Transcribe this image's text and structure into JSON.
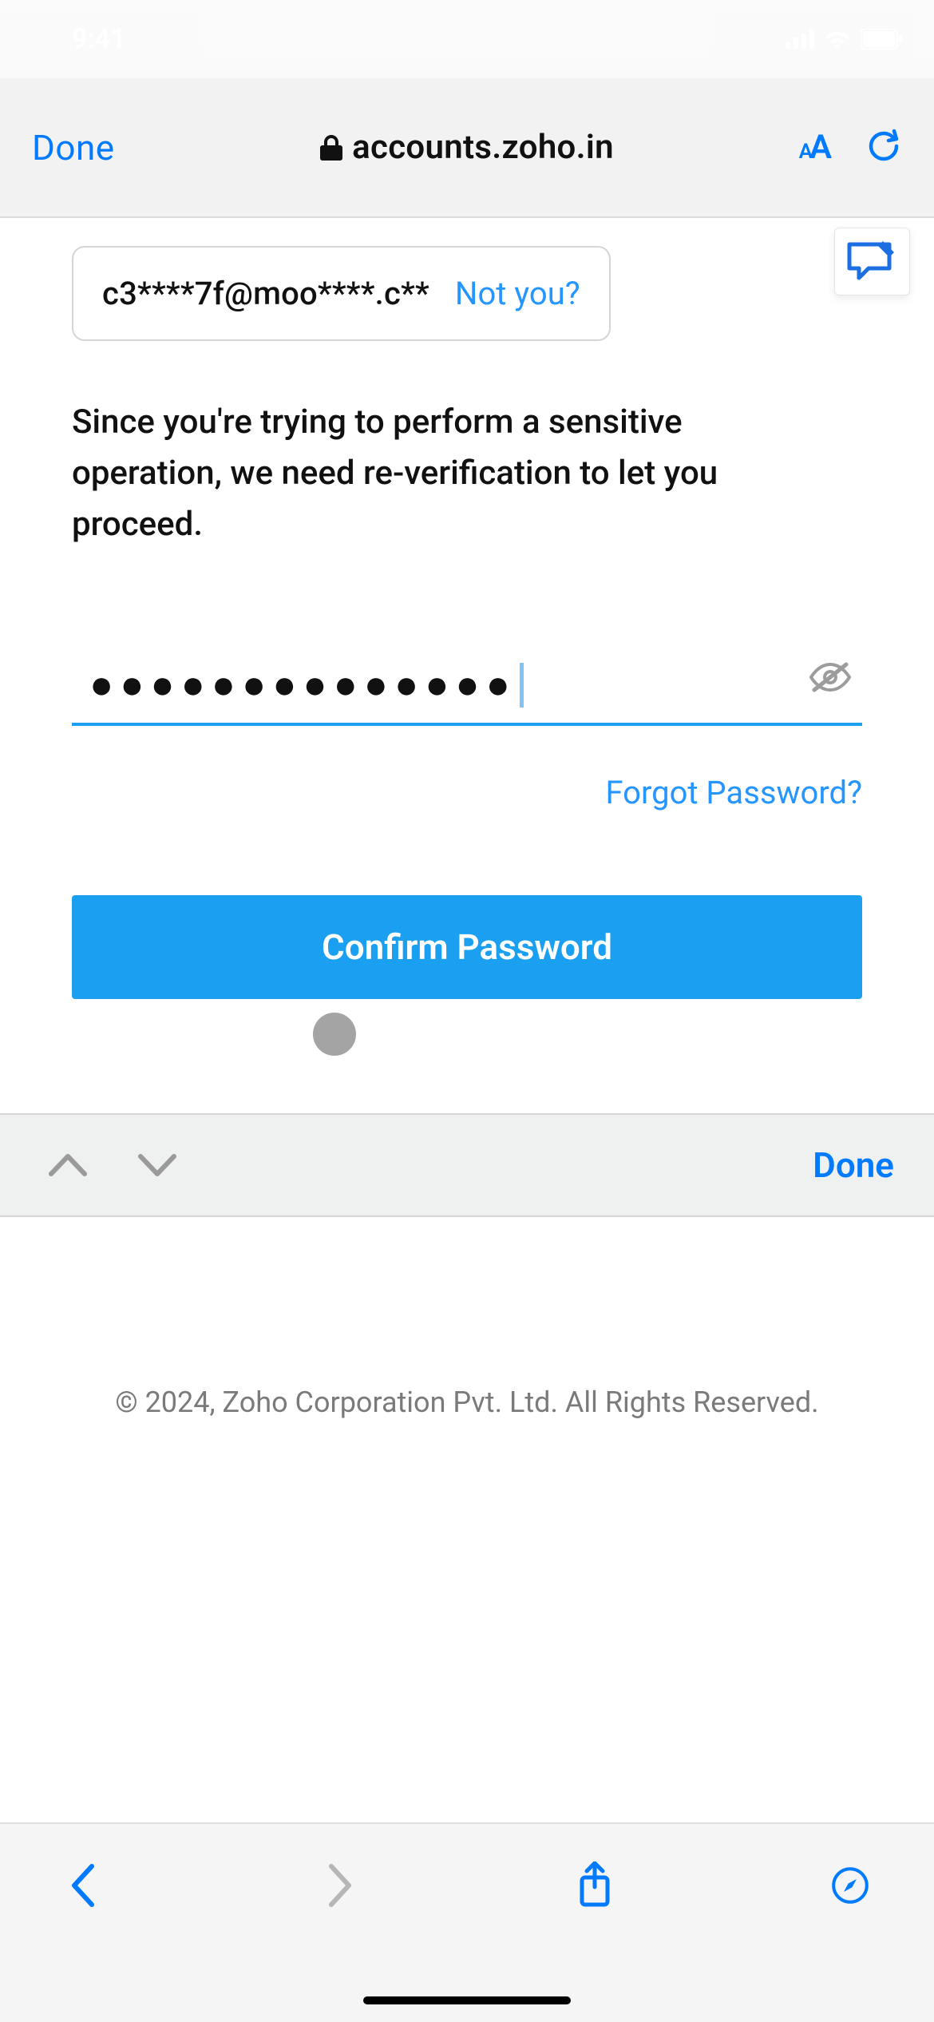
{
  "status_bar": {
    "time": "9:41"
  },
  "browser": {
    "done_label": "Done",
    "host": "accounts.zoho.in"
  },
  "account": {
    "masked_email": "c3****7f@moo****.c**",
    "not_you_label": "Not you?"
  },
  "explain_text": "Since you're trying to perform a sensitive operation, we need re-verification to let you proceed.",
  "password": {
    "masked": "●●●●●●●●●●●●●●",
    "forgot_label": "Forgot Password?",
    "confirm_label": "Confirm Password"
  },
  "keyboard_bar": {
    "done_label": "Done"
  },
  "footer_text": "© 2024, Zoho Corporation Pvt. Ltd. All Rights Reserved."
}
